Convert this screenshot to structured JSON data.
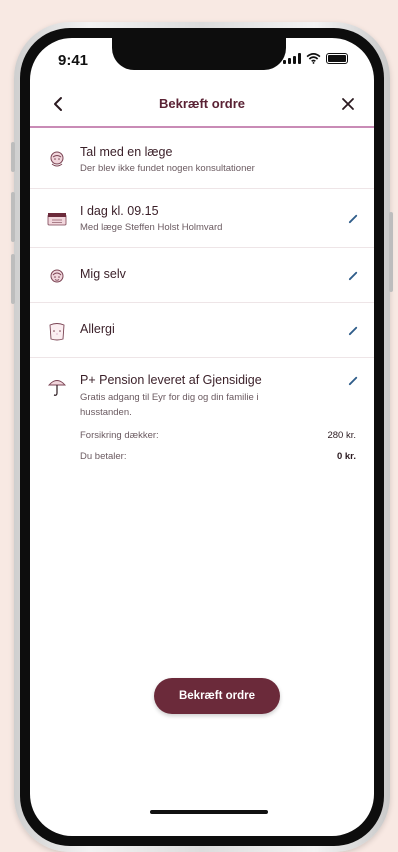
{
  "status": {
    "time": "9:41"
  },
  "header": {
    "title": "Bekræft ordre"
  },
  "items": [
    {
      "title": "Tal med en læge",
      "subtitle": "Der blev ikke fundet nogen konsultationer",
      "icon": "doctor-icon",
      "editable": false
    },
    {
      "title": "I dag kl. 09.15",
      "subtitle": "Med læge Steffen Holst Holmvard",
      "icon": "calendar-icon",
      "editable": true
    },
    {
      "title": "Mig selv",
      "subtitle": "",
      "icon": "person-icon",
      "editable": true
    },
    {
      "title": "Allergi",
      "subtitle": "",
      "icon": "allergy-icon",
      "editable": true
    },
    {
      "title": "P+ Pension leveret af Gjensidige",
      "subtitle": "Gratis adgang til Eyr for dig og din familie i husstanden.",
      "icon": "umbrella-icon",
      "editable": true
    }
  ],
  "insurance": {
    "covers_label": "Forsikring dækker:",
    "covers_value": "280 kr.",
    "pay_label": "Du betaler:",
    "pay_value": "0 kr."
  },
  "confirm_button": "Bekræft ordre",
  "colors": {
    "accent": "#6b2a3a",
    "divider": "#c98bb6",
    "background": "#f8e9e3"
  }
}
